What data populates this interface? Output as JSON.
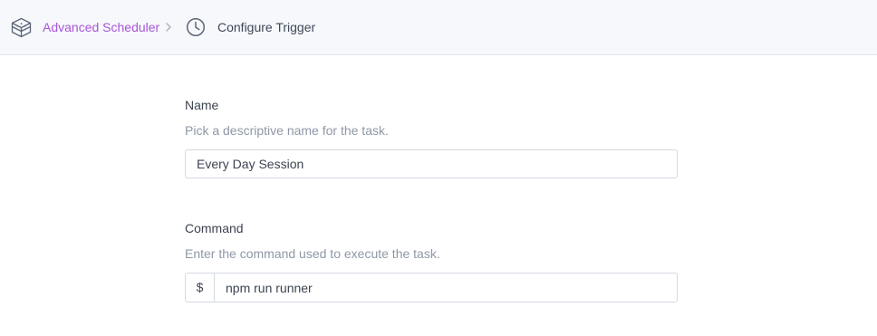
{
  "header": {
    "app_icon": "stack-box-icon",
    "app_link": "Advanced Scheduler",
    "separator_icon": "chevron-right-icon",
    "page_icon": "clock-icon",
    "current_page": "Configure Trigger",
    "link_color": "#a855d9"
  },
  "form": {
    "name": {
      "label": "Name",
      "help": "Pick a descriptive name for the task.",
      "value": "Every Day Session"
    },
    "command": {
      "label": "Command",
      "help": "Enter the command used to execute the task.",
      "prefix": "$",
      "value": "npm run runner"
    }
  }
}
